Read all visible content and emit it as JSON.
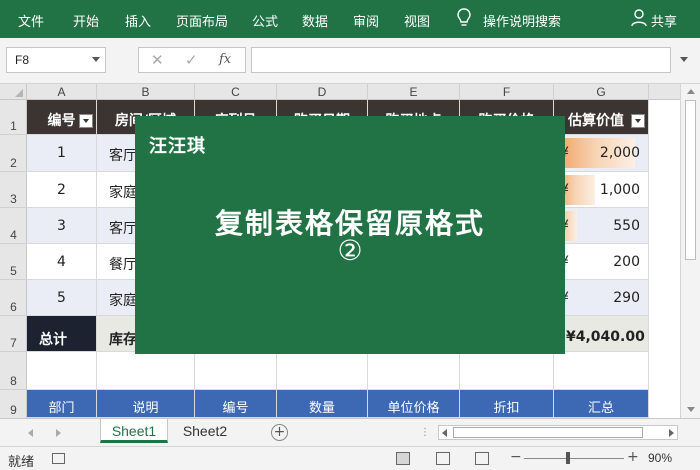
{
  "ribbon": {
    "tabs": [
      "文件",
      "开始",
      "插入",
      "页面布局",
      "公式",
      "数据",
      "审阅",
      "视图"
    ],
    "tell_me": "操作说明搜索",
    "share": "共享"
  },
  "formula_bar": {
    "name_box": "F8",
    "fx_label": "fx",
    "cancel_glyph": "✕",
    "enter_glyph": "✓",
    "formula": ""
  },
  "columns": [
    "A",
    "B",
    "C",
    "D",
    "E",
    "F",
    "G"
  ],
  "rows": [
    "1",
    "2",
    "3",
    "4",
    "5",
    "6",
    "7",
    "8",
    "9"
  ],
  "table": {
    "headers": [
      "编号",
      "房间/区域",
      "序列号",
      "购买日期",
      "购买地点",
      "购买价格",
      "估算价值"
    ],
    "data": [
      {
        "id": "1",
        "room": "客厅",
        "currency": "¥",
        "value": "2,000",
        "level": 1.0
      },
      {
        "id": "2",
        "room": "家庭",
        "currency": "¥",
        "value": "1,000",
        "level": 0.5
      },
      {
        "id": "3",
        "room": "客厅",
        "currency": "¥",
        "value": "550",
        "level": 0.28
      },
      {
        "id": "4",
        "room": "餐厅",
        "currency": "¥",
        "value": "200",
        "level": 0.0
      },
      {
        "id": "5",
        "room": "家庭",
        "currency": "¥",
        "value": "290",
        "level": 0.1
      }
    ],
    "total_label": "总计",
    "inventory_label": "库存",
    "total_value": "¥4,040.00"
  },
  "second_header": [
    "部门",
    "说明",
    "编号",
    "数量",
    "单位价格",
    "折扣",
    "汇总"
  ],
  "overlay": {
    "brand": "汪汪琪",
    "title": "复制表格保留原格式",
    "step": "②"
  },
  "sheets": {
    "tabs": [
      "Sheet1",
      "Sheet2"
    ],
    "active": "Sheet1",
    "add": "+"
  },
  "status": {
    "ready": "就绪",
    "zoom": "90%",
    "zoom_minus": "−",
    "zoom_plus": "+"
  },
  "colors": {
    "ribbon": "#217346",
    "table_header": "#3b3431",
    "alt_row": "#eaedf5",
    "blue_header": "#3d68b3",
    "databar": "#f0a060"
  }
}
